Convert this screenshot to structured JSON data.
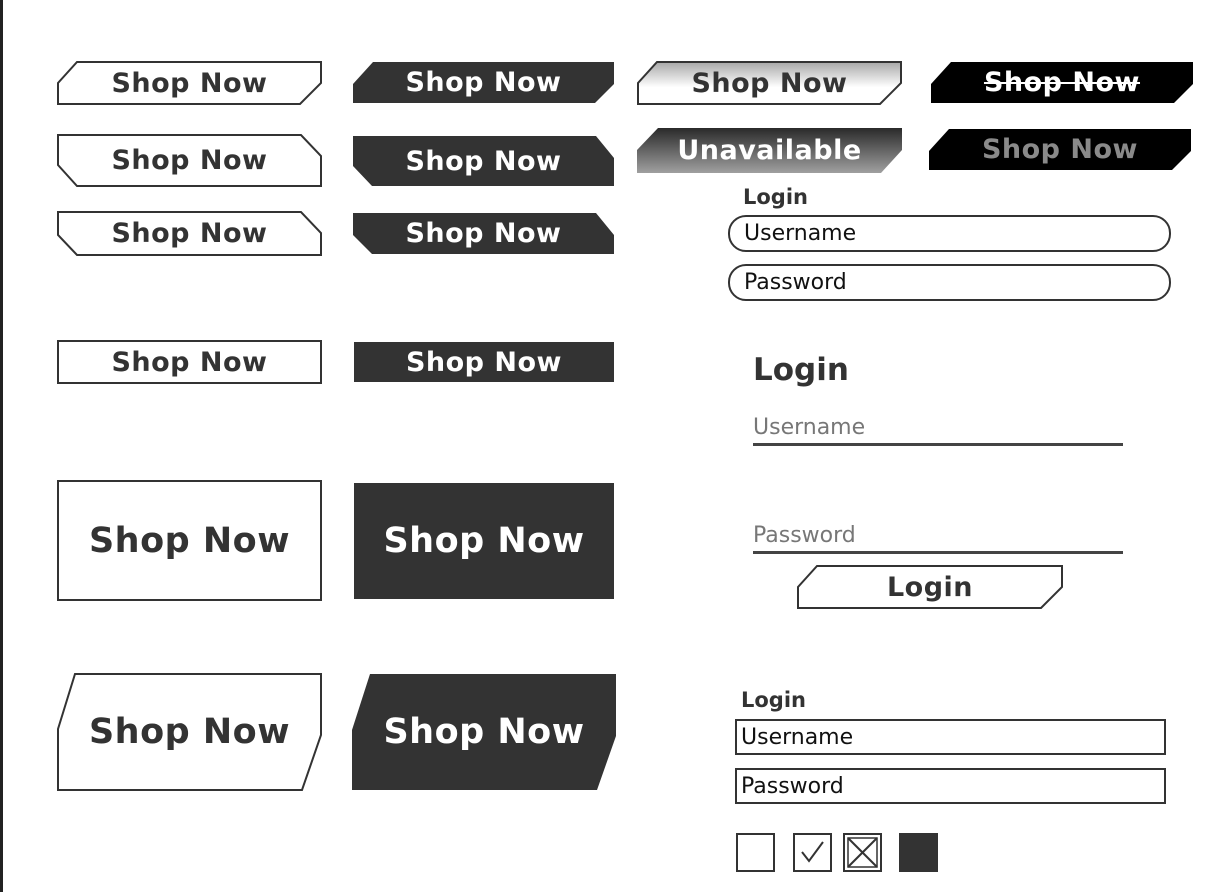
{
  "colors": {
    "dark_fill": "#333333",
    "black_fill": "#000000",
    "stroke": "#333333",
    "grey_text": "#8a8a8a"
  },
  "buttons": {
    "shop_label": "Shop Now",
    "unavailable_label": "Unavailable"
  },
  "login_pill": {
    "title": "Login",
    "username_placeholder": "Username",
    "password_placeholder": "Password"
  },
  "login_underline": {
    "title": "Login",
    "username_placeholder": "Username",
    "password_placeholder": "Password",
    "submit_label": "Login"
  },
  "login_box": {
    "title": "Login",
    "username_placeholder": "Username",
    "password_placeholder": "Password"
  },
  "checkboxes": [
    {
      "state": "unchecked",
      "icon": "empty-checkbox-icon"
    },
    {
      "state": "checked",
      "icon": "checkmark-icon"
    },
    {
      "state": "crossed",
      "icon": "cross-icon"
    },
    {
      "state": "filled",
      "icon": "filled-square-icon"
    }
  ]
}
